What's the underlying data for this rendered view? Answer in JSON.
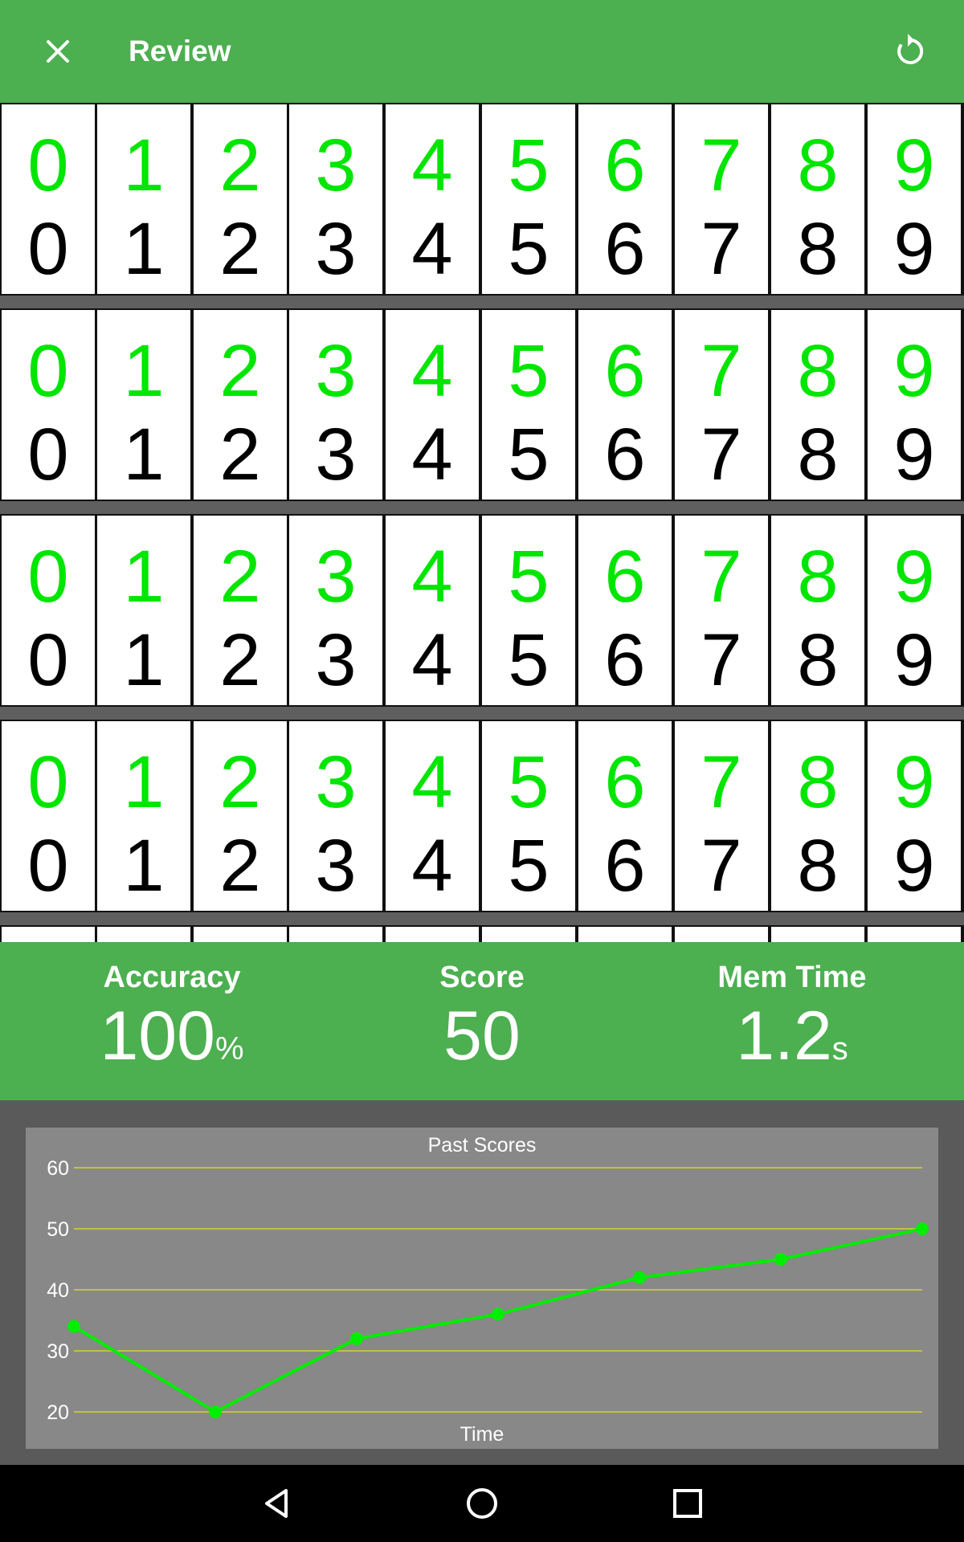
{
  "app_bar": {
    "title": "Review",
    "close_icon": "close-icon",
    "refresh_icon": "refresh-icon",
    "color": "#4caf50"
  },
  "rows": [
    {
      "recalled": [
        "0",
        "1",
        "2",
        "3",
        "4",
        "5",
        "6",
        "7",
        "8",
        "9"
      ],
      "answers": [
        "0",
        "1",
        "2",
        "3",
        "4",
        "5",
        "6",
        "7",
        "8",
        "9"
      ]
    },
    {
      "recalled": [
        "0",
        "1",
        "2",
        "3",
        "4",
        "5",
        "6",
        "7",
        "8",
        "9"
      ],
      "answers": [
        "0",
        "1",
        "2",
        "3",
        "4",
        "5",
        "6",
        "7",
        "8",
        "9"
      ]
    },
    {
      "recalled": [
        "0",
        "1",
        "2",
        "3",
        "4",
        "5",
        "6",
        "7",
        "8",
        "9"
      ],
      "answers": [
        "0",
        "1",
        "2",
        "3",
        "4",
        "5",
        "6",
        "7",
        "8",
        "9"
      ]
    },
    {
      "recalled": [
        "0",
        "1",
        "2",
        "3",
        "4",
        "5",
        "6",
        "7",
        "8",
        "9"
      ],
      "answers": [
        "0",
        "1",
        "2",
        "3",
        "4",
        "5",
        "6",
        "7",
        "8",
        "9"
      ]
    }
  ],
  "colors": {
    "correct": "#00e600",
    "answer": "#000000",
    "chart_line": "#00ee00",
    "gridline": "#d4d42a"
  },
  "stats": {
    "accuracy": {
      "label": "Accuracy",
      "value": "100",
      "unit": "%"
    },
    "score": {
      "label": "Score",
      "value": "50",
      "unit": ""
    },
    "mem_time": {
      "label": "Mem Time",
      "value": "1.2",
      "unit": "s"
    }
  },
  "chart_data": {
    "type": "line",
    "title": "Past Scores",
    "xlabel": "Time",
    "ylabel": "",
    "ylim": [
      20,
      60
    ],
    "yticks": [
      "20",
      "30",
      "40",
      "50",
      "60"
    ],
    "grid": true,
    "series": [
      {
        "values": [
          34,
          20,
          32,
          36,
          42,
          45,
          50
        ]
      }
    ]
  },
  "nav": {
    "back_icon": "back-icon",
    "home_icon": "home-icon",
    "recents_icon": "recents-icon"
  }
}
